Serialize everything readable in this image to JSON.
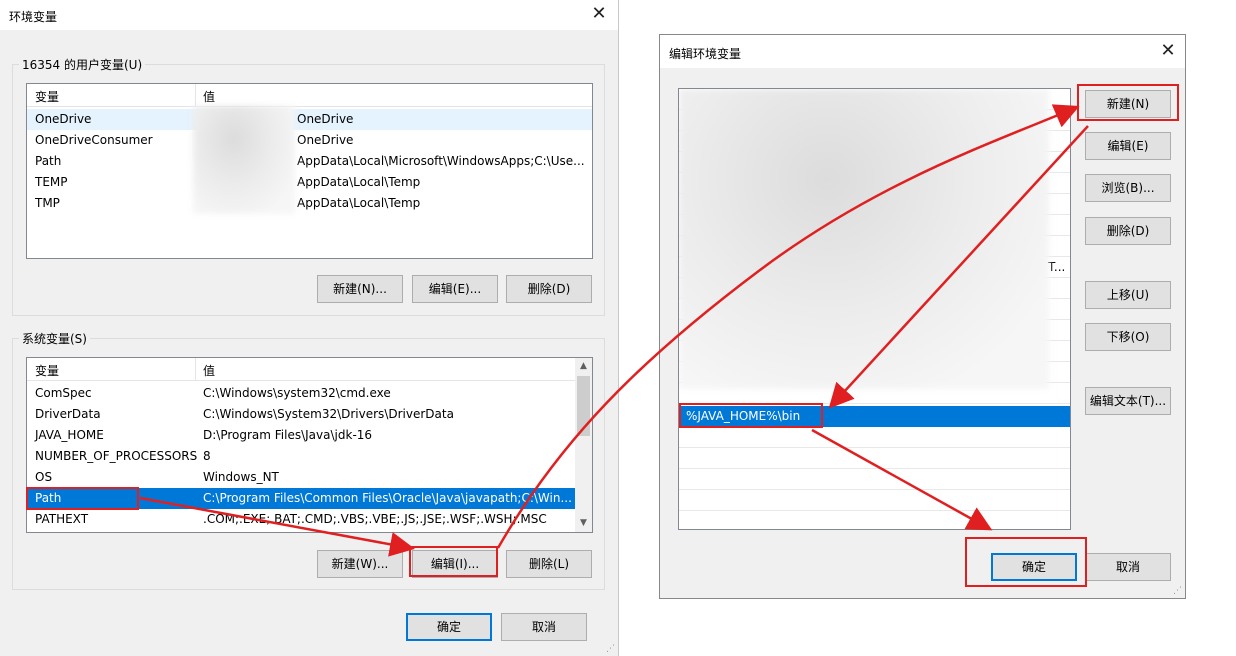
{
  "env_dialog": {
    "title": "环境变量",
    "close_glyph": "✕",
    "user_group": {
      "legend": "16354 的用户变量(U)",
      "col_var": "变量",
      "col_val": "值",
      "rows": [
        {
          "name": "OneDrive",
          "value": "OneDrive"
        },
        {
          "name": "OneDriveConsumer",
          "value": "OneDrive"
        },
        {
          "name": "Path",
          "value": "AppData\\Local\\Microsoft\\WindowsApps;C:\\Use..."
        },
        {
          "name": "TEMP",
          "value": "AppData\\Local\\Temp"
        },
        {
          "name": "TMP",
          "value": "AppData\\Local\\Temp"
        }
      ],
      "buttons": {
        "new": "新建(N)...",
        "edit": "编辑(E)...",
        "delete": "删除(D)"
      }
    },
    "system_group": {
      "legend": "系统变量(S)",
      "col_var": "变量",
      "col_val": "值",
      "rows": [
        {
          "name": "ComSpec",
          "value": "C:\\Windows\\system32\\cmd.exe"
        },
        {
          "name": "DriverData",
          "value": "C:\\Windows\\System32\\Drivers\\DriverData"
        },
        {
          "name": "JAVA_HOME",
          "value": "D:\\Program Files\\Java\\jdk-16"
        },
        {
          "name": "NUMBER_OF_PROCESSORS",
          "value": "8"
        },
        {
          "name": "OS",
          "value": "Windows_NT"
        },
        {
          "name": "Path",
          "value": "C:\\Program Files\\Common Files\\Oracle\\Java\\javapath;C:\\Win..."
        },
        {
          "name": "PATHEXT",
          "value": ".COM;.EXE;.BAT;.CMD;.VBS;.VBE;.JS;.JSE;.WSF;.WSH;.MSC"
        }
      ],
      "buttons": {
        "new": "新建(W)...",
        "edit": "编辑(I)...",
        "delete": "删除(L)"
      }
    },
    "ok": "确定",
    "cancel": "取消"
  },
  "edit_dialog": {
    "title": "编辑环境变量",
    "close_glyph": "✕",
    "visible_entry_fragment": "T...",
    "selected_entry": "%JAVA_HOME%\\bin",
    "buttons": {
      "new": "新建(N)",
      "edit": "编辑(E)",
      "browse": "浏览(B)...",
      "delete": "删除(D)",
      "move_up": "上移(U)",
      "move_down": "下移(O)",
      "edit_text": "编辑文本(T)..."
    },
    "ok": "确定",
    "cancel": "取消"
  },
  "colors": {
    "selection": "#0078d7",
    "annotation_red": "#e02020",
    "dialog_bg": "#f0f0f0"
  }
}
